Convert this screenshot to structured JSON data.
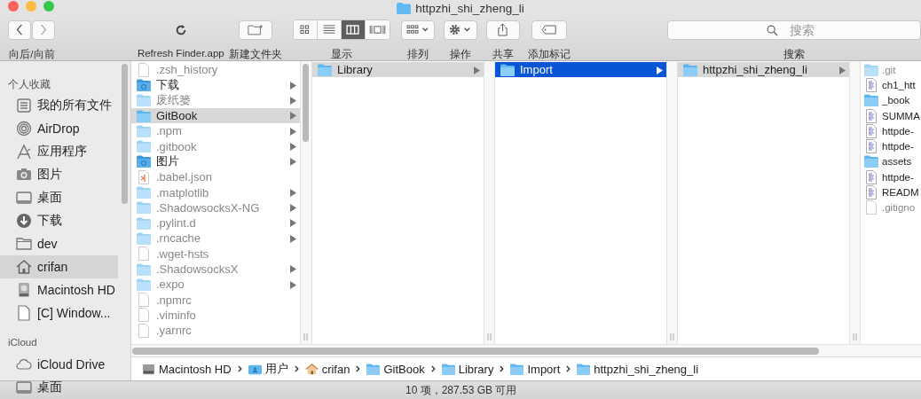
{
  "window": {
    "title": "httpzhi_shi_zheng_li"
  },
  "toolbar": [
    {
      "kind": "nav",
      "label": "向后/向前"
    },
    {
      "kind": "refresh",
      "label": "Refresh Finder.app"
    },
    {
      "kind": "new_folder",
      "label": "新建文件夹"
    },
    {
      "kind": "view",
      "label": "显示",
      "segments": [
        {
          "selected": false
        },
        {
          "selected": false
        },
        {
          "selected": true
        },
        {
          "selected": false
        }
      ]
    },
    {
      "kind": "arrange",
      "label": "排列"
    },
    {
      "kind": "action",
      "label": "操作"
    },
    {
      "kind": "share",
      "label": "共享"
    },
    {
      "kind": "tag",
      "label": "添加标记"
    },
    {
      "kind": "search",
      "label": "搜索",
      "placeholder": "搜索"
    }
  ],
  "sidebar": [
    {
      "title": "个人收藏",
      "items": [
        {
          "label": "我的所有文件",
          "kind": "allfiles",
          "selected": false
        },
        {
          "label": "AirDrop",
          "kind": "airdrop",
          "selected": false
        },
        {
          "label": "应用程序",
          "kind": "apps",
          "selected": false
        },
        {
          "label": "图片",
          "kind": "camera",
          "selected": false
        },
        {
          "label": "桌面",
          "kind": "desktop",
          "selected": false
        },
        {
          "label": "下载",
          "kind": "download",
          "selected": false
        },
        {
          "label": "dev",
          "kind": "folder",
          "selected": false
        },
        {
          "label": "crifan",
          "kind": "home",
          "selected": true
        },
        {
          "label": "Macintosh HD",
          "kind": "disk",
          "selected": false
        },
        {
          "label": "[C] Window...",
          "kind": "file",
          "selected": false
        }
      ]
    },
    {
      "title": "iCloud",
      "items": [
        {
          "label": "iCloud Drive",
          "kind": "cloud",
          "selected": false
        },
        {
          "label": "桌面",
          "kind": "desktop",
          "selected": false
        }
      ]
    }
  ],
  "columns": [
    {
      "focused": false,
      "items": [
        {
          "name": ".zsh_history",
          "kind": "file",
          "dimmed": true,
          "has_children": false,
          "selected": false
        },
        {
          "name": "下载",
          "kind": "special_folder",
          "dimmed": false,
          "has_children": true,
          "selected": false
        },
        {
          "name": "废纸篓",
          "kind": "folder",
          "dimmed": true,
          "has_children": true,
          "selected": false
        },
        {
          "name": "GitBook",
          "kind": "folder",
          "dimmed": false,
          "has_children": true,
          "selected": true
        },
        {
          "name": ".npm",
          "kind": "folder",
          "dimmed": true,
          "has_children": true,
          "selected": false
        },
        {
          "name": ".gitbook",
          "kind": "folder",
          "dimmed": true,
          "has_children": true,
          "selected": false
        },
        {
          "name": "图片",
          "kind": "special_folder",
          "dimmed": false,
          "has_children": true,
          "selected": false
        },
        {
          "name": ".babel.json",
          "kind": "code",
          "dimmed": true,
          "has_children": false,
          "selected": false
        },
        {
          "name": ".matplotlib",
          "kind": "folder",
          "dimmed": true,
          "has_children": true,
          "selected": false
        },
        {
          "name": ".ShadowsocksX-NG",
          "kind": "folder",
          "dimmed": true,
          "has_children": true,
          "selected": false
        },
        {
          "name": ".pylint.d",
          "kind": "folder",
          "dimmed": true,
          "has_children": true,
          "selected": false
        },
        {
          "name": ".rncache",
          "kind": "folder",
          "dimmed": true,
          "has_children": true,
          "selected": false
        },
        {
          "name": ".wget-hsts",
          "kind": "file",
          "dimmed": true,
          "has_children": false,
          "selected": false
        },
        {
          "name": ".ShadowsocksX",
          "kind": "folder",
          "dimmed": true,
          "has_children": true,
          "selected": false
        },
        {
          "name": ".expo",
          "kind": "folder",
          "dimmed": true,
          "has_children": true,
          "selected": false
        },
        {
          "name": ".npmrc",
          "kind": "file",
          "dimmed": true,
          "has_children": false,
          "selected": false
        },
        {
          "name": ".viminfo",
          "kind": "file",
          "dimmed": true,
          "has_children": false,
          "selected": false
        },
        {
          "name": ".yarnrc",
          "kind": "file",
          "dimmed": true,
          "has_children": false,
          "selected": false
        }
      ]
    },
    {
      "focused": false,
      "items": [
        {
          "name": "Library",
          "kind": "folder",
          "dimmed": false,
          "has_children": true,
          "selected": true
        }
      ]
    },
    {
      "focused": true,
      "items": [
        {
          "name": "Import",
          "kind": "folder",
          "dimmed": false,
          "has_children": true,
          "selected": true
        }
      ]
    },
    {
      "focused": false,
      "items": [
        {
          "name": "httpzhi_shi_zheng_li",
          "kind": "folder",
          "dimmed": false,
          "has_children": true,
          "selected": true
        }
      ]
    },
    {
      "items": [
        {
          "name": ".git",
          "kind": "folder",
          "dimmed": true,
          "has_children": false,
          "selected": false
        },
        {
          "name": "ch1_htt",
          "kind": "doc",
          "dimmed": false,
          "has_children": false,
          "selected": false
        },
        {
          "name": "_book",
          "kind": "folder",
          "dimmed": false,
          "has_children": false,
          "selected": false
        },
        {
          "name": "SUMMA",
          "kind": "doc",
          "dimmed": false,
          "has_children": false,
          "selected": false
        },
        {
          "name": "httpde-",
          "kind": "doc",
          "dimmed": false,
          "has_children": false,
          "selected": false
        },
        {
          "name": "httpde-",
          "kind": "doc",
          "dimmed": false,
          "has_children": false,
          "selected": false
        },
        {
          "name": "assets",
          "kind": "folder",
          "dimmed": false,
          "has_children": false,
          "selected": false
        },
        {
          "name": "httpde-",
          "kind": "doc",
          "dimmed": false,
          "has_children": false,
          "selected": false
        },
        {
          "name": "READM",
          "kind": "doc",
          "dimmed": false,
          "has_children": false,
          "selected": false
        },
        {
          "name": ".gitigno",
          "kind": "file",
          "dimmed": true,
          "has_children": false,
          "selected": false
        }
      ]
    }
  ],
  "path_bar": [
    {
      "label": "Macintosh HD",
      "kind": "disk"
    },
    {
      "label": "用户",
      "kind": "user_folder"
    },
    {
      "label": "crifan",
      "kind": "home"
    },
    {
      "label": "GitBook",
      "kind": "folder"
    },
    {
      "label": "Library",
      "kind": "folder"
    },
    {
      "label": "Import",
      "kind": "folder"
    },
    {
      "label": "httpzhi_shi_zheng_li",
      "kind": "folder"
    }
  ],
  "status_bar": "10 项，287.53 GB 可用"
}
